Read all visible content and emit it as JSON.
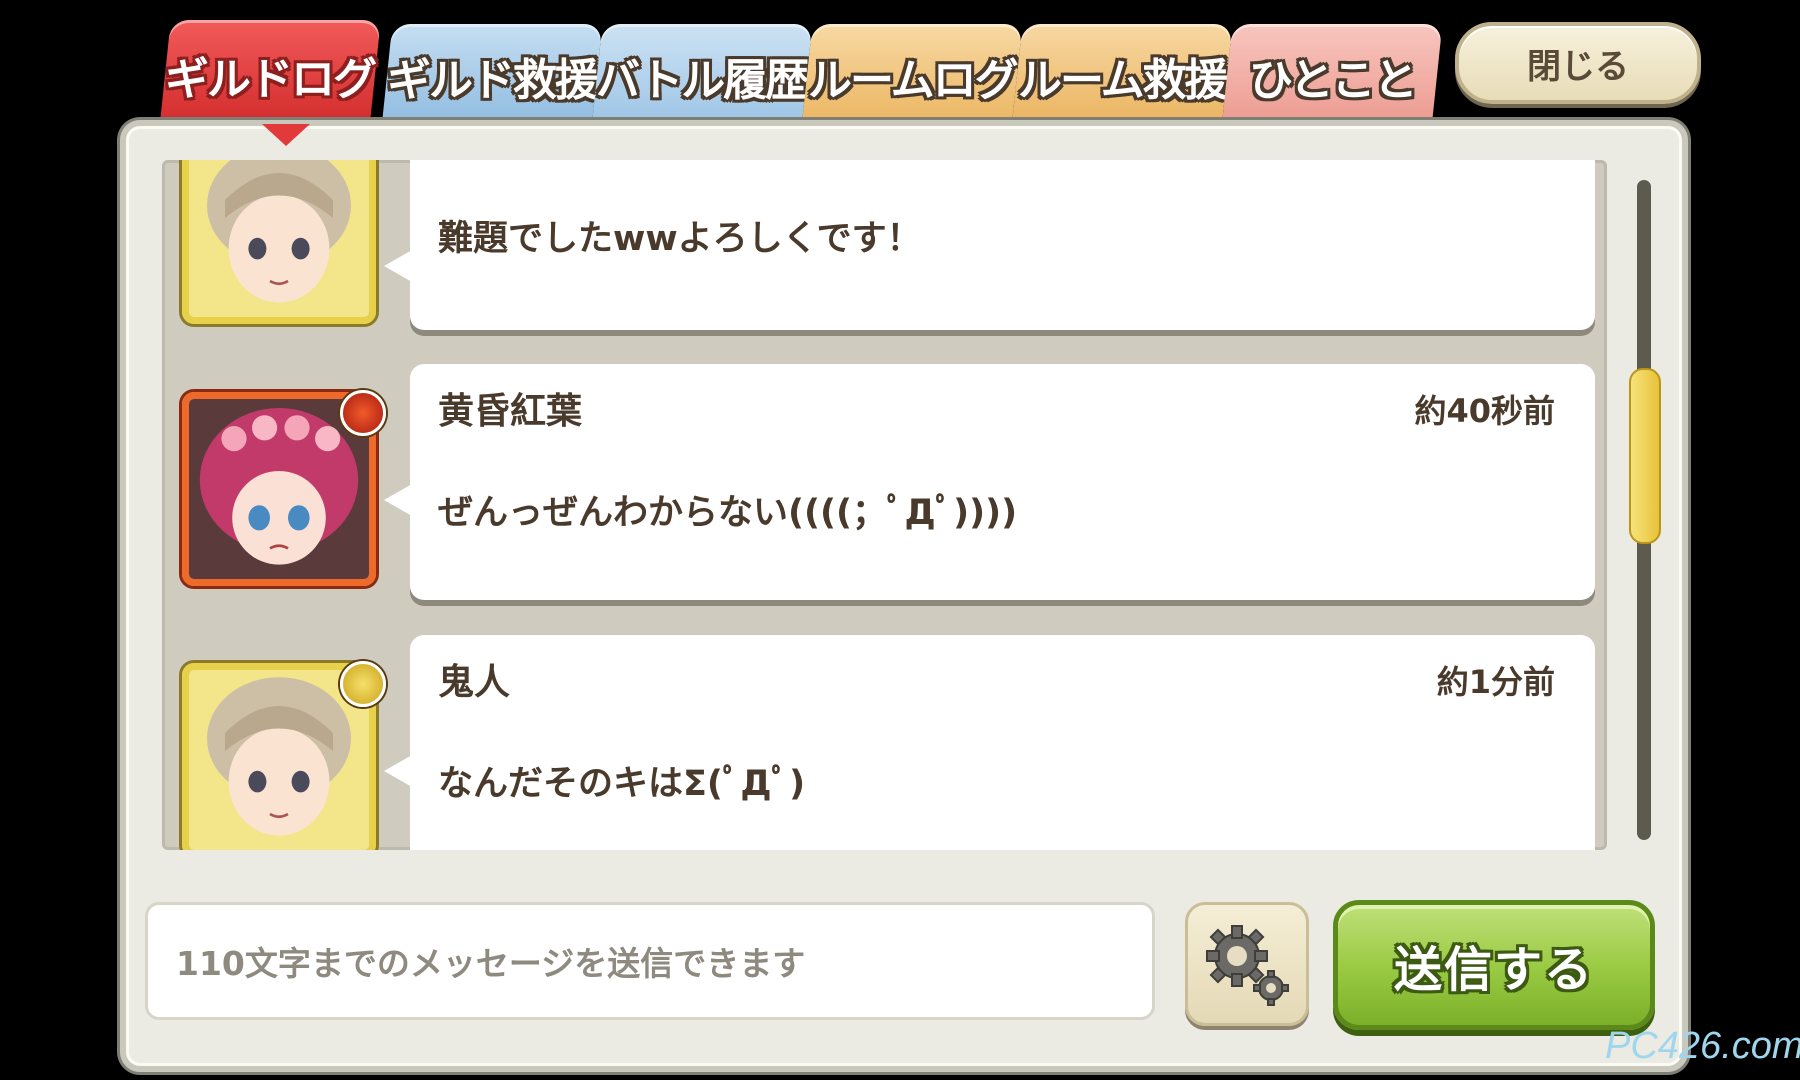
{
  "tabs": [
    {
      "label": "ギルドログ",
      "color": "#e23a3a",
      "active": true
    },
    {
      "label": "ギルド救援",
      "color": "#9cc6e8",
      "active": false
    },
    {
      "label": "バトル履歴",
      "color": "#a9cdea",
      "active": false
    },
    {
      "label": "ルームログ",
      "color": "#f2c27a",
      "active": false
    },
    {
      "label": "ルーム救援",
      "color": "#f0c079",
      "active": false
    },
    {
      "label": "ひとこと",
      "color": "#f2a8a0",
      "active": false
    }
  ],
  "close_label": "閉じる",
  "messages": [
    {
      "sender": "",
      "time": "",
      "text": "難題でしたwwよろしくです！",
      "avatar": "blonde-girl-avatar"
    },
    {
      "sender": "黄昏紅葉",
      "time": "約40秒前",
      "text": "ぜんっぜんわからない((((；ﾟДﾟ))))",
      "avatar": "pink-hair-girl-avatar"
    },
    {
      "sender": "鬼人",
      "time": "約1分前",
      "text": "なんだそのキはΣ(ﾟДﾟ)",
      "avatar": "blonde-girl-avatar"
    }
  ],
  "input": {
    "placeholder": "110文字までのメッセージを送信できます"
  },
  "send_label": "送信する",
  "watermark": "PC426.com",
  "colors": {
    "accent": "#e23a3a",
    "send": "#9ccb45",
    "frame": "#ecebe3"
  }
}
